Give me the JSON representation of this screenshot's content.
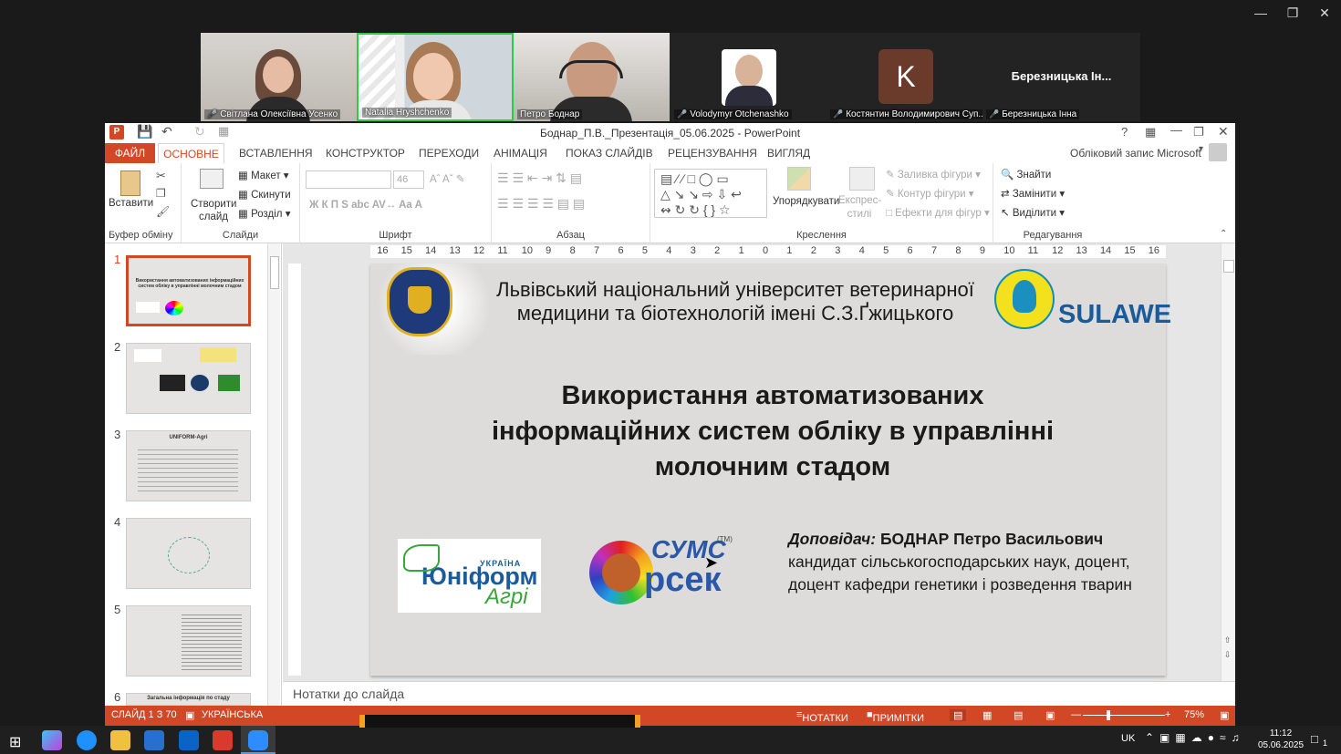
{
  "zoom": {
    "participants": [
      {
        "name": "Світлана Олексіївна Усенко",
        "muted": true
      },
      {
        "name": "Natalia Hryshchenko",
        "muted": false
      },
      {
        "name": "Петро Боднар",
        "muted": false
      },
      {
        "name": "Volodymyr Otchenashko",
        "muted": true
      },
      {
        "name": "Костянтин Володимирович Суп...",
        "muted": true,
        "initial": "K"
      },
      {
        "name": "Березницька Інна",
        "muted": true,
        "display": "Березницька Ін..."
      }
    ]
  },
  "ppt": {
    "window_title": "Боднар_П.В._Презентація_05.06.2025 - PowerPoint",
    "account": "Обліковий запис Microsoft",
    "tabs": [
      "ФАЙЛ",
      "ОСНОВНЕ",
      "ВСТАВЛЕННЯ",
      "КОНСТРУКТОР",
      "ПЕРЕХОДИ",
      "АНІМАЦІЯ",
      "ПОКАЗ СЛАЙДІВ",
      "РЕЦЕНЗУВАННЯ",
      "ВИГЛЯД"
    ],
    "ribbon": {
      "clipboard": {
        "label": "Буфер обміну",
        "paste": "Вставити"
      },
      "slides": {
        "label": "Слайди",
        "new_slide": "Створити слайд",
        "layout": "Макет",
        "reset": "Скинути",
        "section": "Розділ"
      },
      "font": {
        "label": "Шрифт",
        "size": "46"
      },
      "paragraph": {
        "label": "Абзац"
      },
      "drawing": {
        "label": "Креслення",
        "arrange": "Упорядкувати",
        "quick_styles": "Експрес-стилі",
        "fill": "Заливка фігури",
        "outline": "Контур фігури",
        "effects": "Ефекти для фігур"
      },
      "editing": {
        "label": "Редагування",
        "find": "Знайти",
        "replace": "Замінити",
        "select": "Виділити"
      }
    },
    "thumbs": [
      {
        "n": "1",
        "title": "Використання автоматизованих інформаційних систем обліку в управлінні молочним стадом"
      },
      {
        "n": "2",
        "title": ""
      },
      {
        "n": "3",
        "title": "UNIFORM-Agri"
      },
      {
        "n": "4",
        "title": ""
      },
      {
        "n": "5",
        "title": ""
      },
      {
        "n": "6",
        "title": "Загальна інформація по стаду"
      }
    ],
    "ruler": [
      "16",
      "15",
      "14",
      "13",
      "12",
      "11",
      "10",
      "9",
      "8",
      "7",
      "6",
      "5",
      "4",
      "3",
      "2",
      "1",
      "0",
      "1",
      "2",
      "3",
      "4",
      "5",
      "6",
      "7",
      "8",
      "9",
      "10",
      "11",
      "12",
      "13",
      "14",
      "15",
      "16"
    ],
    "slide": {
      "university": "Львівський національний університет ветеринарної медицини та біотехнологій імені С.З.Ґжицького",
      "sulawe": "SULAWE",
      "title": "Використання автоматизованих інформаційних систем обліку в управлінні молочним стадом",
      "speaker_label": "Доповідач:",
      "speaker_name": "БОДНАР Петро Васильович",
      "speaker_details": "кандидат сільськогосподарських наук, доцент, доцент кафедри генетики і розведення тварин",
      "logo_uniform": "Юніформ",
      "logo_uniform_sub": "Агрі",
      "logo_uniform_top": "УКРАЇНА",
      "logo_syms": "СУМС",
      "logo_orsek": "рсек",
      "logo_tm": "(TM)"
    },
    "notes_placeholder": "Нотатки до слайда",
    "status": {
      "slide": "СЛАЙД 1 З 70",
      "lang": "УКРАЇНСЬКА",
      "notes": "НОТАТКИ",
      "comments": "ПРИМІТКИ",
      "zoom": "75%"
    }
  },
  "taskbar": {
    "lang": "UK",
    "time": "11:12",
    "date": "05.06.2025",
    "notif": "1"
  }
}
